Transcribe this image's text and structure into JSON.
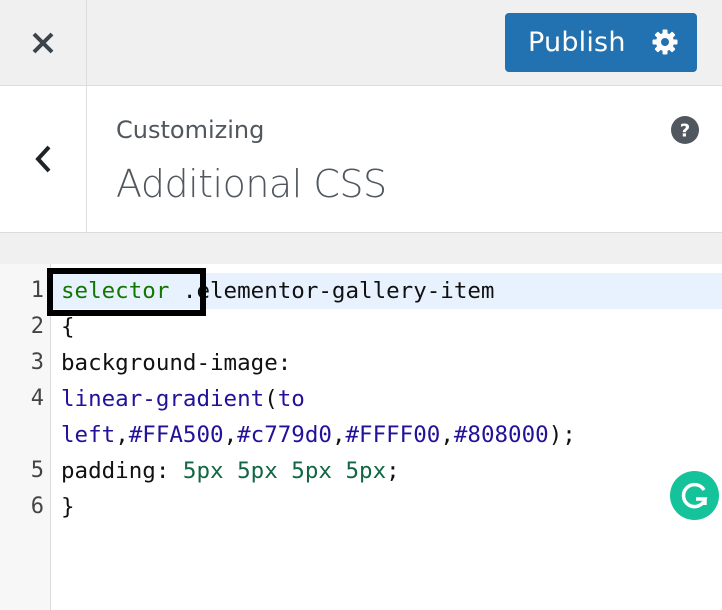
{
  "toolbar": {
    "close_icon": "close-icon",
    "publish_label": "Publish",
    "settings_icon": "gear-icon",
    "publish_color": "#2271b1"
  },
  "section": {
    "back_icon": "chevron-left-icon",
    "action": "Customizing",
    "title": "Additional CSS",
    "help_icon": "question-circle-icon"
  },
  "editor": {
    "line_numbers": [
      "1",
      "2",
      "3",
      "4",
      "5",
      "6"
    ],
    "lines": [
      [
        {
          "text": "selector",
          "type": "tag"
        },
        {
          "text": " .elementor-gallery-item",
          "type": "plain"
        }
      ],
      [
        {
          "text": "{",
          "type": "plain"
        }
      ],
      [
        {
          "text": "background-image:",
          "type": "plain"
        }
      ],
      [
        {
          "text": "linear-gradient",
          "type": "kw"
        },
        {
          "text": "(",
          "type": "plain"
        },
        {
          "text": "to",
          "type": "kw"
        }
      ],
      [
        {
          "text": "left",
          "type": "kw"
        },
        {
          "text": ",",
          "type": "plain"
        },
        {
          "text": "#FFA500",
          "type": "kw"
        },
        {
          "text": ",",
          "type": "plain"
        },
        {
          "text": "#c779d0",
          "type": "kw"
        },
        {
          "text": ",",
          "type": "plain"
        },
        {
          "text": "#FFFF00",
          "type": "kw"
        },
        {
          "text": ",",
          "type": "plain"
        },
        {
          "text": "#808000",
          "type": "kw"
        },
        {
          "text": ");",
          "type": "plain"
        }
      ],
      [
        {
          "text": "padding: ",
          "type": "plain"
        },
        {
          "text": "5px 5px 5px 5px",
          "type": "num"
        },
        {
          "text": ";",
          "type": "plain"
        }
      ],
      [
        {
          "text": "}",
          "type": "plain"
        }
      ]
    ],
    "active_line": "1",
    "highlighted_token": "selector"
  },
  "grammarly": {
    "icon": "grammarly-icon",
    "color": "#15c39a"
  }
}
